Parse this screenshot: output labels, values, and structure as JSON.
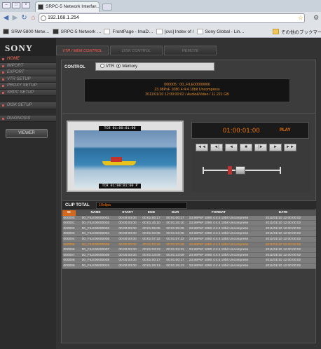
{
  "browser": {
    "tab_title": "SRPC-5 Network Interfa…",
    "tab_close": "×",
    "url": "192.168.1.254",
    "bookmarks": [
      {
        "label": "SRW-5800 Netw…",
        "icon": "dark"
      },
      {
        "label": "SRPC-5 Network …",
        "icon": "dark"
      },
      {
        "label": "FrontPage - ImaD…",
        "icon": "page"
      },
      {
        "label": "[cvs] Index of /",
        "icon": "page"
      },
      {
        "label": "Sony Global - Lin…",
        "icon": "page"
      },
      {
        "label": "その他のブックマー…",
        "icon": "folder"
      }
    ]
  },
  "app": {
    "logo": "SONY",
    "nav": [
      {
        "label": "HOME",
        "active": true
      },
      {
        "label": "IMPORT"
      },
      {
        "label": "EXPORT"
      },
      {
        "label": "VTR SETUP"
      },
      {
        "label": "PROXY SETUP"
      },
      {
        "label": "SRPC SETUP"
      }
    ],
    "nav2": [
      {
        "label": "DISK SETUP"
      }
    ],
    "nav3": [
      {
        "label": "DIAGNOSIS"
      }
    ],
    "viewer_label": "VIEWER",
    "tabs": [
      {
        "label": "VTR / MEM CONTROL",
        "active": true
      },
      {
        "label": "DISK CONTROL"
      },
      {
        "label": "REMOTE"
      }
    ],
    "control_label": "CONTROL",
    "control_options": [
      "VTR",
      "Memory"
    ],
    "control_selected": "Memory",
    "info_lines": [
      "000005 : 00_FILE00000006",
      "23.98PsF 1080 4:4:4 10bit Uncompress",
      "2011/01/10 12:00:00:02 / Audio&Video / 11.221 GB"
    ],
    "video_tc_top": "TCR 01:00:01:00",
    "video_tc_bottom": "TCR 01:00:01:00 P",
    "timecode": "01:00:01:00",
    "mode": "PLAY",
    "transport_buttons": [
      "◄◄",
      "◄|",
      "◄",
      "■",
      "|►",
      "►",
      "►►"
    ],
    "clip_total_label": "CLIP TOTAL",
    "clip_total_value": "10clips",
    "table": {
      "headers": [
        "ID",
        "NAME",
        "START",
        "END",
        "DUR",
        "FORMAT",
        "DATE"
      ],
      "rows": [
        [
          "000000",
          "00_FILE00000001",
          "00:00:00:00",
          "00:01:00:17",
          "00:01:00:17",
          "23.98PsF 1080 4:4:4 10bit Uncompress",
          "2011/01/10 12:00:00:02"
        ],
        [
          "000001",
          "00_FILE00000002",
          "00:00:00:00",
          "00:01:45:10",
          "00:01:45:10",
          "23.98PsF 1080 4:4:4 10bit Uncompress",
          "2011/01/10 12:00:00:02"
        ],
        [
          "000002",
          "00_FILE00000003",
          "00:00:00:00",
          "00:01:05:05",
          "00:01:05:05",
          "23.98PsF 1080 4:4:4 10bit Uncompress",
          "2011/01/10 12:00:00:02"
        ],
        [
          "000003",
          "00_FILE00000004",
          "00:00:00:00",
          "00:01:02:05",
          "00:01:02:05",
          "23.98PsF 1080 4:4:4 10bit Uncompress",
          "2011/01/10 12:00:00:02"
        ],
        [
          "000004",
          "00_FILE00000005",
          "00:00:00:00",
          "00:01:07:22",
          "00:01:07:22",
          "23.98PsF 1080 4:4:4 10bit Uncompress",
          "2011/01/10 12:00:00:02"
        ],
        [
          "000005",
          "00_FILE00000006",
          "00:00:00:00",
          "00:01:03:28",
          "00:01:03:28",
          "23.98PsF 1080 4:4:4 10bit Uncompress",
          "2011/01/10 12:00:00:02"
        ],
        [
          "000006",
          "00_FILE00000007",
          "00:00:00:00",
          "00:01:03:23",
          "00:01:03:23",
          "23.98PsF 1080 4:4:4 10bit Uncompress",
          "2011/01/10 12:00:00:02"
        ],
        [
          "000007",
          "00_FILE00000008",
          "00:00:00:00",
          "00:01:13:09",
          "00:01:13:09",
          "23.98PsF 1080 4:4:4 10bit Uncompress",
          "2011/01/10 12:00:00:02"
        ],
        [
          "000008",
          "00_FILE00000009",
          "00:00:00:00",
          "00:01:00:17",
          "00:01:00:17",
          "23.98PsF 1080 4:4:4 10bit Uncompress",
          "2011/01/10 12:00:00:02"
        ],
        [
          "000009",
          "00_FILE00000010",
          "00:00:00:00",
          "00:01:26:13",
          "00:01:26:13",
          "23.98PsF 1080 4:4:4 10bit Uncompress",
          "2011/01/10 12:00:00:02"
        ]
      ],
      "selected_row": 5
    }
  }
}
